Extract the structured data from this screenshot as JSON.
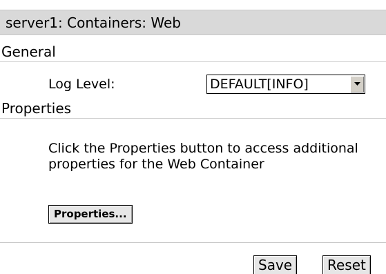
{
  "header": {
    "title": "server1: Containers: Web"
  },
  "general": {
    "heading": "General",
    "log_level": {
      "label": "Log Level:",
      "selected": "DEFAULT[INFO]"
    }
  },
  "properties": {
    "heading": "Properties",
    "description": "Click the Properties button to access additional properties for the Web Container",
    "button_label": "Properties..."
  },
  "footer": {
    "save_label": "Save",
    "reset_label": "Reset"
  },
  "icons": {
    "select_arrow": "chevron-down-icon"
  },
  "colors": {
    "title_bar": "#d9d9d9",
    "button_face": "#e6e6e6",
    "select_arrow_face": "#d4d0c8"
  }
}
